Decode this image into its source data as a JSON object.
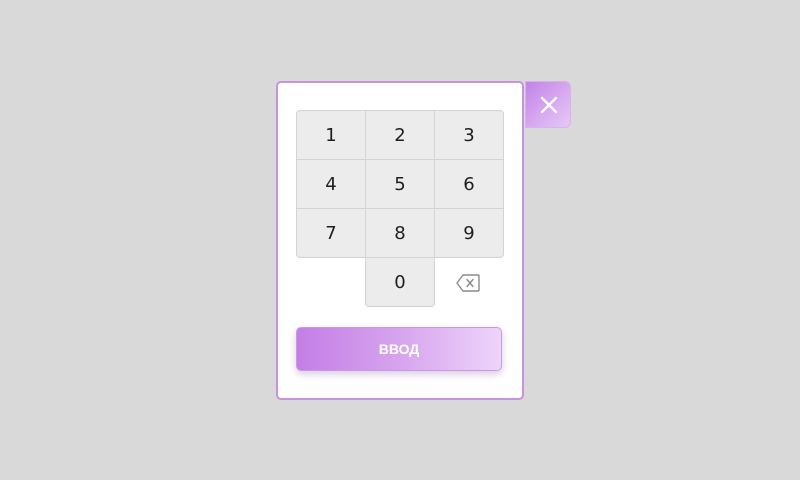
{
  "keypad": {
    "keys": [
      "1",
      "2",
      "3",
      "4",
      "5",
      "6",
      "7",
      "8",
      "9",
      "0"
    ]
  },
  "actions": {
    "enter_label": "ВВОД",
    "close_icon": "close-icon",
    "backspace_icon": "backspace-icon"
  },
  "colors": {
    "accent": "#c47ee6",
    "panel_border": "#c992dc",
    "key_bg": "#ececec",
    "background": "#d9d9d9"
  }
}
